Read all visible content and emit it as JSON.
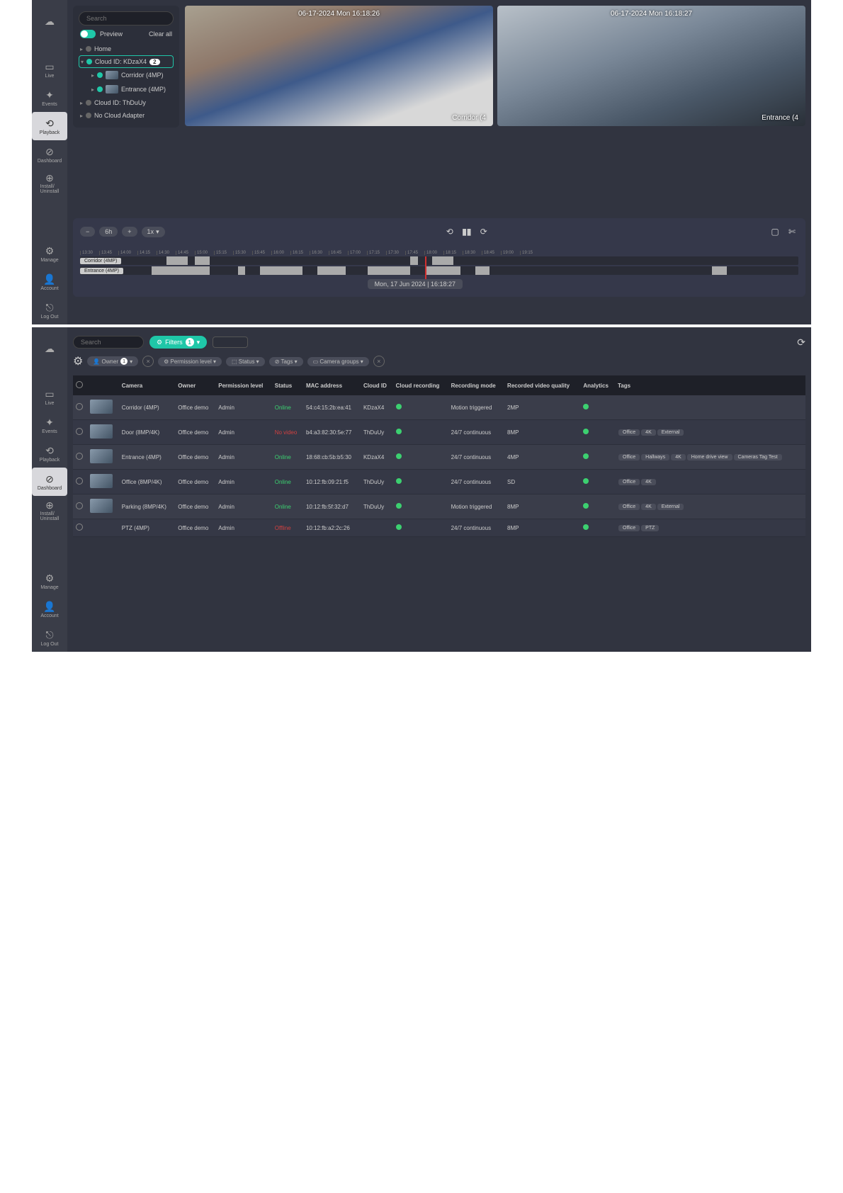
{
  "nav": {
    "items": [
      "Live",
      "Events",
      "Playback",
      "Dashboard",
      "Install/\nUninstall",
      "Manage",
      "Account",
      "Log Out"
    ],
    "active_top": "Playback",
    "active_bottom": "Dashboard"
  },
  "tree": {
    "search_ph": "Search",
    "preview": "Preview",
    "clear": "Clear all",
    "nodes": [
      {
        "label": "Home",
        "dot": "grey"
      },
      {
        "label": "Cloud ID: KDzaX4",
        "dot": "green",
        "badge": "2",
        "sel": true
      },
      {
        "label": "Corridor (4MP)",
        "dot": "green",
        "child": true,
        "thumb": true
      },
      {
        "label": "Entrance (4MP)",
        "dot": "green",
        "child": true,
        "thumb": true
      },
      {
        "label": "Cloud ID: ThDuUy",
        "dot": "grey"
      },
      {
        "label": "No Cloud Adapter",
        "dot": "grey"
      }
    ]
  },
  "video": {
    "f1_ts": "06-17-2024 Mon 16:18:26",
    "f1_lbl": "Corridor (4",
    "f2_ts": "06-17-2024 Mon 16:18:27",
    "f2_lbl": "Entrance (4"
  },
  "timeline": {
    "zoom": "6h",
    "speed": "1x",
    "ticks": [
      "13:30",
      "13:45",
      "14:00",
      "14:15",
      "14:30",
      "14:45",
      "15:00",
      "15:15",
      "15:30",
      "15:45",
      "16:00",
      "16:15",
      "16:30",
      "16:45",
      "17:00",
      "17:15",
      "17:30",
      "17:45",
      "18:00",
      "18:15",
      "18:30",
      "18:45",
      "19:00",
      "19:15"
    ],
    "tracks": [
      "Corridor (4MP)",
      "Entrance (4MP)"
    ],
    "label": "Mon, 17 Jun 2024 | 16:18:27"
  },
  "dash": {
    "search_ph": "Search",
    "filters_label": "Filters",
    "filters_count": "1",
    "chips": [
      {
        "ic": "👤",
        "label": "Owner",
        "cnt": "1"
      },
      {
        "ic": "⚙",
        "label": "Permission level"
      },
      {
        "ic": "⬚",
        "label": "Status"
      },
      {
        "ic": "⊘",
        "label": "Tags"
      },
      {
        "ic": "▭",
        "label": "Camera groups"
      }
    ],
    "headers": [
      "",
      "",
      "Camera",
      "Owner",
      "Permission level",
      "Status",
      "MAC address",
      "Cloud ID",
      "Cloud recording",
      "Recording mode",
      "Recorded video quality",
      "Analytics",
      "Tags"
    ],
    "rows": [
      {
        "camera": "Corridor (4MP)",
        "owner": "Office demo",
        "perm": "Admin",
        "status": "Online",
        "sc": "online",
        "mac": "54:c4:15:2b:ea:41",
        "cloud": "KDzaX4",
        "rec": "●",
        "mode": "Motion triggered",
        "qual": "2MP",
        "an": "●",
        "tags": []
      },
      {
        "camera": "Door (8MP/4K)",
        "owner": "Office demo",
        "perm": "Admin",
        "status": "No video",
        "sc": "novideo",
        "mac": "b4:a3:82:30:5e:77",
        "cloud": "ThDuUy",
        "rec": "●",
        "mode": "24/7 continuous",
        "qual": "8MP",
        "an": "●",
        "tags": [
          "Office",
          "4K",
          "External"
        ]
      },
      {
        "camera": "Entrance (4MP)",
        "owner": "Office demo",
        "perm": "Admin",
        "status": "Online",
        "sc": "online",
        "mac": "18:68:cb:5b:b5:30",
        "cloud": "KDzaX4",
        "rec": "●",
        "mode": "24/7 continuous",
        "qual": "4MP",
        "an": "●",
        "tags": [
          "Office",
          "Hallways",
          "4K",
          "Home drive view",
          "Cameras Tag Test"
        ]
      },
      {
        "camera": "Office (8MP/4K)",
        "owner": "Office demo",
        "perm": "Admin",
        "status": "Online",
        "sc": "online",
        "mac": "10:12:fb:09:21:f5",
        "cloud": "ThDuUy",
        "rec": "●",
        "mode": "24/7 continuous",
        "qual": "SD",
        "an": "●",
        "tags": [
          "Office",
          "4K"
        ]
      },
      {
        "camera": "Parking (8MP/4K)",
        "owner": "Office demo",
        "perm": "Admin",
        "status": "Online",
        "sc": "online",
        "mac": "10:12:fb:5f:32:d7",
        "cloud": "ThDuUy",
        "rec": "●",
        "mode": "Motion triggered",
        "qual": "8MP",
        "an": "●",
        "tags": [
          "Office",
          "4K",
          "External"
        ]
      },
      {
        "camera": "PTZ (4MP)",
        "owner": "Office demo",
        "perm": "Admin",
        "status": "Offline",
        "sc": "offline",
        "mac": "10:12:fb:a2:2c:26",
        "cloud": "",
        "rec": "●",
        "mode": "24/7 continuous",
        "qual": "8MP",
        "an": "●",
        "tags": [
          "Office",
          "PTZ"
        ],
        "nothumb": true
      }
    ]
  }
}
